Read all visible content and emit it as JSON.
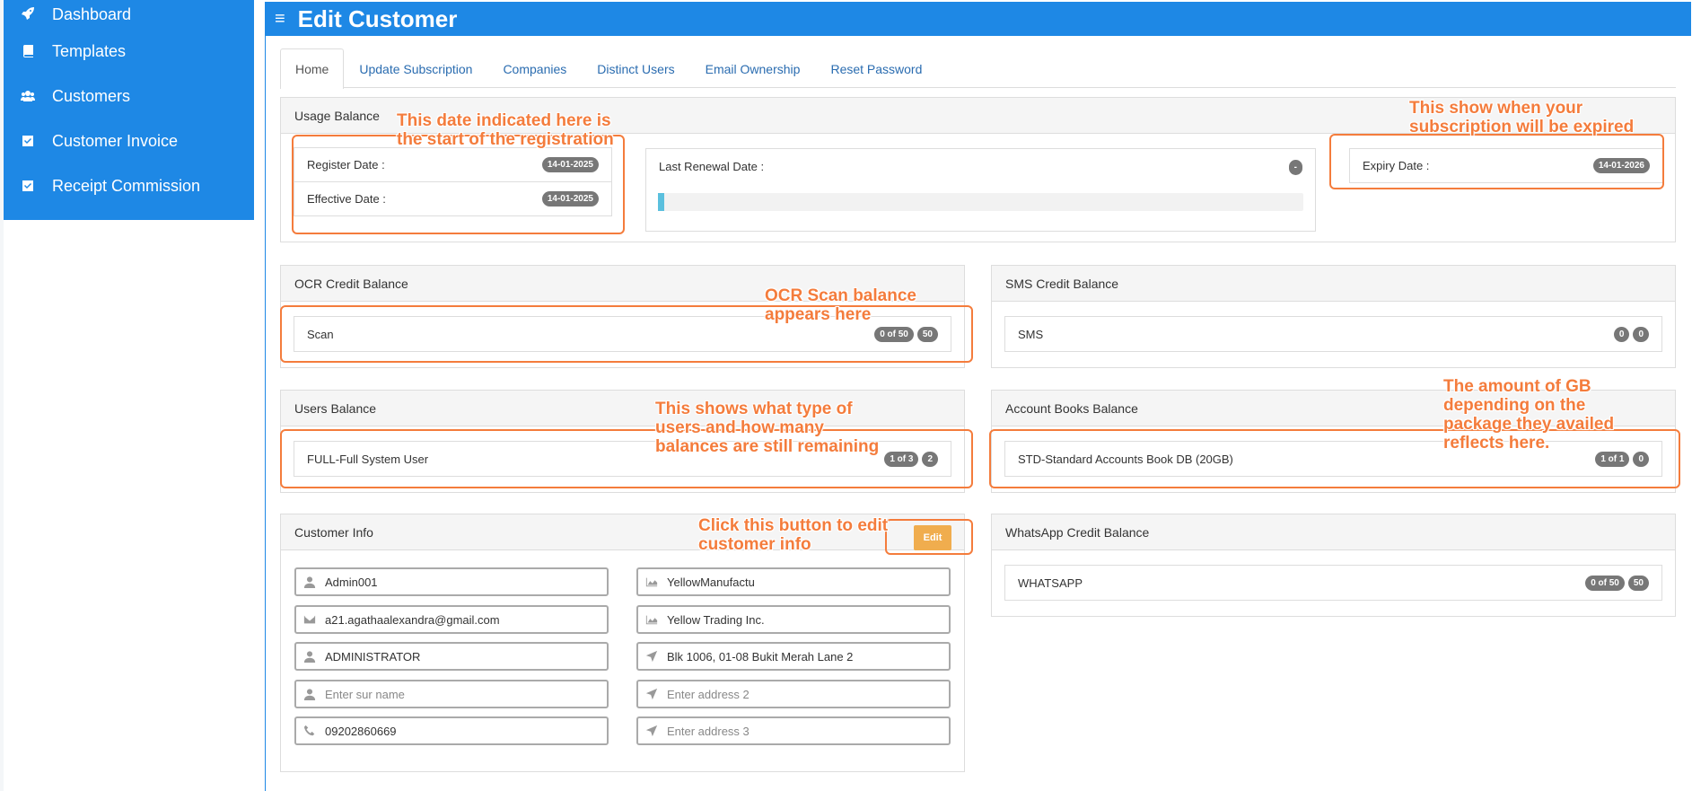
{
  "sidebar": {
    "items": [
      {
        "label": "Dashboard",
        "icon": "rocket-icon"
      },
      {
        "label": "Templates",
        "icon": "book-icon"
      },
      {
        "label": "Customers",
        "icon": "users-icon"
      },
      {
        "label": "Customer Invoice",
        "icon": "checkbox-icon"
      },
      {
        "label": "Receipt Commission",
        "icon": "checkbox-icon"
      }
    ]
  },
  "header": {
    "title": "Edit Customer",
    "menu_icon": "hamburger-icon"
  },
  "tabs": [
    {
      "label": "Home",
      "active": true
    },
    {
      "label": "Update Subscription"
    },
    {
      "label": "Companies"
    },
    {
      "label": "Distinct Users"
    },
    {
      "label": "Email Ownership"
    },
    {
      "label": "Reset Password"
    }
  ],
  "usage": {
    "title": "Usage Balance",
    "register_label": "Register Date :",
    "register_value": "14-01-2025",
    "effective_label": "Effective Date :",
    "effective_value": "14-01-2025",
    "renewal_label": "Last Renewal Date :",
    "renewal_value": "-",
    "expiry_label": "Expiry Date :",
    "expiry_value": "14-01-2026",
    "progress": 0.01
  },
  "ocr": {
    "title": "OCR Credit Balance",
    "label": "Scan",
    "badge1": "0 of 50",
    "badge2": "50"
  },
  "sms": {
    "title": "SMS Credit Balance",
    "label": "SMS",
    "badge1": "0",
    "badge2": "0"
  },
  "users": {
    "title": "Users Balance",
    "label": "FULL-Full System User",
    "badge1": "1 of 3",
    "badge2": "2"
  },
  "books": {
    "title": "Account Books Balance",
    "label": "STD-Standard Accounts Book DB (20GB)",
    "badge1": "1 of 1",
    "badge2": "0"
  },
  "whatsapp": {
    "title": "WhatsApp Credit Balance",
    "label": "WHATSAPP",
    "badge1": "0 of 50",
    "badge2": "50"
  },
  "customer": {
    "title": "Customer Info",
    "edit_label": "Edit",
    "username": "Admin001",
    "email": "a21.agathaalexandra@gmail.com",
    "name": "ADMINISTRATOR",
    "surname_placeholder": "Enter sur name",
    "phone": "09202860669",
    "company_short": "YellowManufactu",
    "company_name": "Yellow Trading Inc.",
    "address1": "Blk 1006, 01-08 Bukit Merah Lane 2",
    "address2_placeholder": "Enter address 2",
    "address3_placeholder": "Enter address 3"
  },
  "annotations": {
    "registration": "This date indicated here is\nthe start of the registration",
    "expiry": "This show when your\nsubscription will be expired",
    "ocr": "OCR Scan balance\nappears here",
    "users": "This shows what type of\nusers and how many\nbalances are still remaining",
    "books": "The amount of GB\ndepending on the\npackage they availed\nreflects here.",
    "edit": "Click this button to edit\ncustomer info"
  },
  "colors": {
    "brand": "#1e88e5",
    "annotation": "#f47c3c",
    "edit_button": "#f0ad4e"
  }
}
